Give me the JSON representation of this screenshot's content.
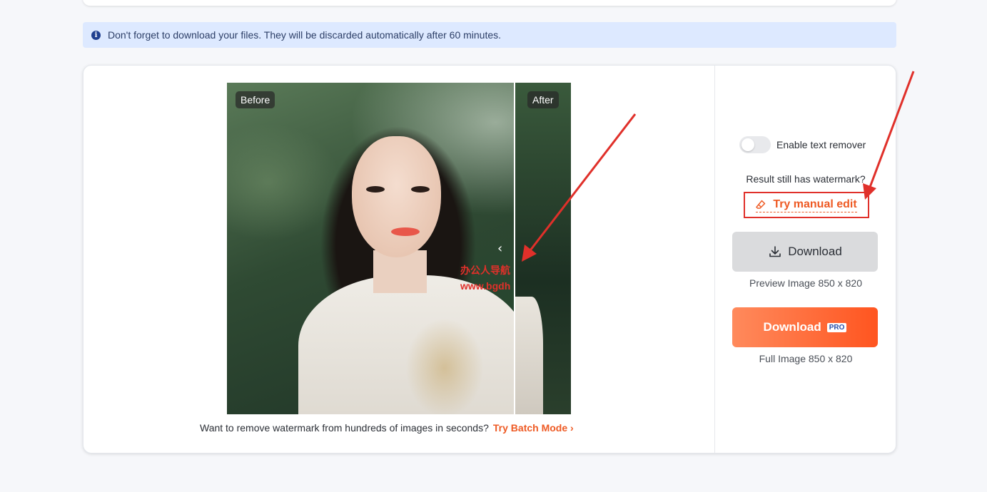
{
  "notice": {
    "text": "Don't forget to download your files. They will be discarded automatically after 60 minutes."
  },
  "preview": {
    "before_label": "Before",
    "after_label": "After",
    "watermark_line1": "办公人导航",
    "watermark_line2": "www.bgdh"
  },
  "batch": {
    "prompt": "Want to remove watermark from hundreds of images in seconds?",
    "link": "Try Batch Mode"
  },
  "sidebar": {
    "toggle_label": "Enable text remover",
    "still_watermark": "Result still has watermark?",
    "manual_edit": "Try manual edit",
    "download_label": "Download",
    "preview_caption": "Preview Image 850 x 820",
    "download_pro_label": "Download",
    "pro_badge": "PRO",
    "full_caption": "Full Image 850 x 820"
  },
  "colors": {
    "accent": "#ee5a24",
    "annotation": "#e0302a",
    "notice_bg": "#dde9ff"
  }
}
